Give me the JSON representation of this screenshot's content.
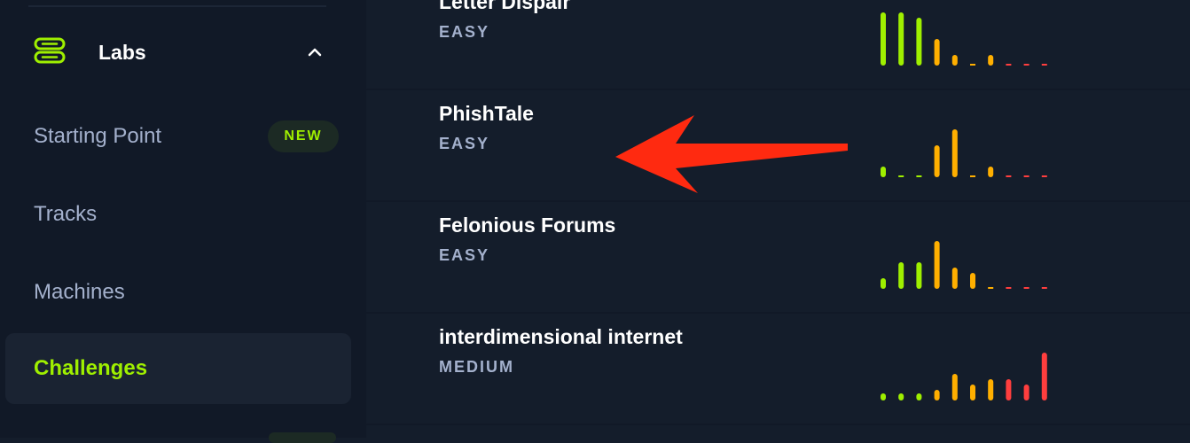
{
  "sidebar": {
    "labs": {
      "label": "Labs",
      "icon": "server-stack-icon",
      "expanded": true
    },
    "items": [
      {
        "label": "Starting Point",
        "badge": "NEW"
      },
      {
        "label": "Tracks"
      },
      {
        "label": "Machines"
      },
      {
        "label": "Challenges",
        "active": true
      }
    ]
  },
  "challenges": [
    {
      "name": "Letter Dispair",
      "difficulty": "EASY",
      "rating_votes": [
        10,
        10,
        9,
        5,
        2,
        0,
        2,
        0,
        0,
        0
      ]
    },
    {
      "name": "PhishTale",
      "difficulty": "EASY",
      "rating_votes": [
        2,
        0,
        0,
        6,
        9,
        0,
        2,
        0,
        0,
        0
      ]
    },
    {
      "name": "Felonious Forums",
      "difficulty": "EASY",
      "rating_votes": [
        2,
        5,
        5,
        9,
        4,
        3,
        0,
        0,
        0,
        0
      ]
    },
    {
      "name": "interdimensional internet",
      "difficulty": "MEDIUM",
      "rating_votes": [
        1,
        1,
        1,
        2,
        5,
        3,
        4,
        4,
        3,
        9
      ]
    }
  ],
  "colors": {
    "accent": "#9fef00",
    "bar_easy": "#9fef00",
    "bar_medium": "#ffaf00",
    "bar_hard": "#ff3e3e",
    "arrow": "#ff2a10"
  }
}
